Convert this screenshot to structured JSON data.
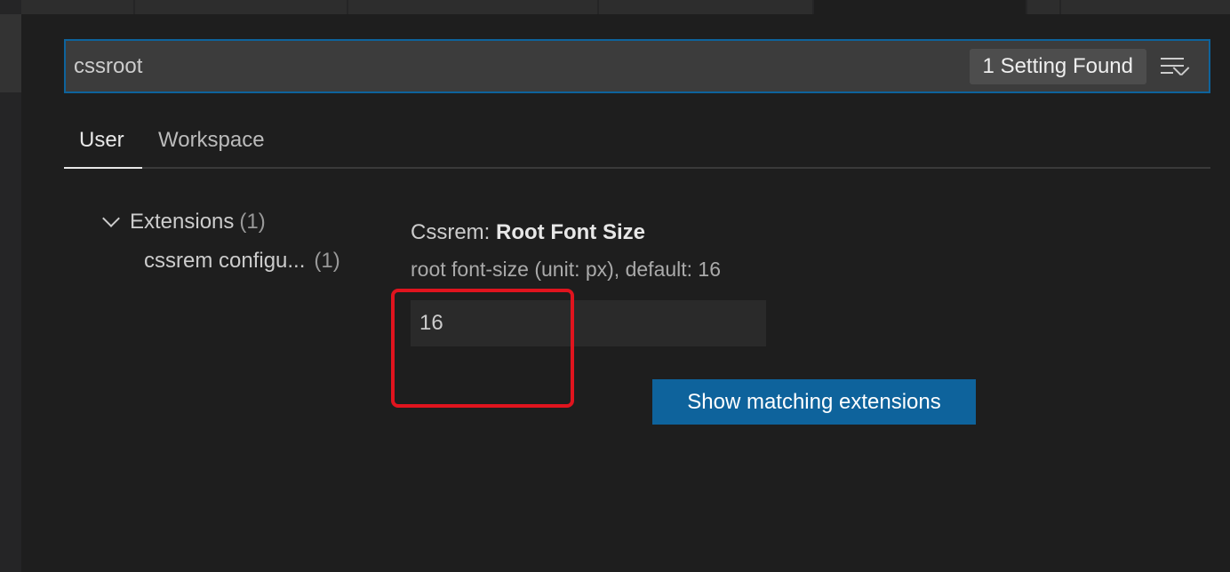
{
  "search": {
    "value": "cssroot",
    "result_count": "1 Setting Found",
    "clear_icon": "clear-filter-icon"
  },
  "tabs": [
    {
      "label": "User"
    },
    {
      "label": "Workspace"
    }
  ],
  "tree": {
    "group": {
      "label": "Extensions",
      "count": "(1)"
    },
    "child": {
      "label": "cssrem configu...",
      "count": "(1)"
    }
  },
  "setting": {
    "category": "Cssrem: ",
    "name": "Root Font Size",
    "description": "root font-size (unit: px), default: 16",
    "value": "16"
  },
  "button": {
    "label": "Show matching extensions"
  },
  "colors": {
    "accent": "#0e639c",
    "highlight": "#e0141e"
  }
}
